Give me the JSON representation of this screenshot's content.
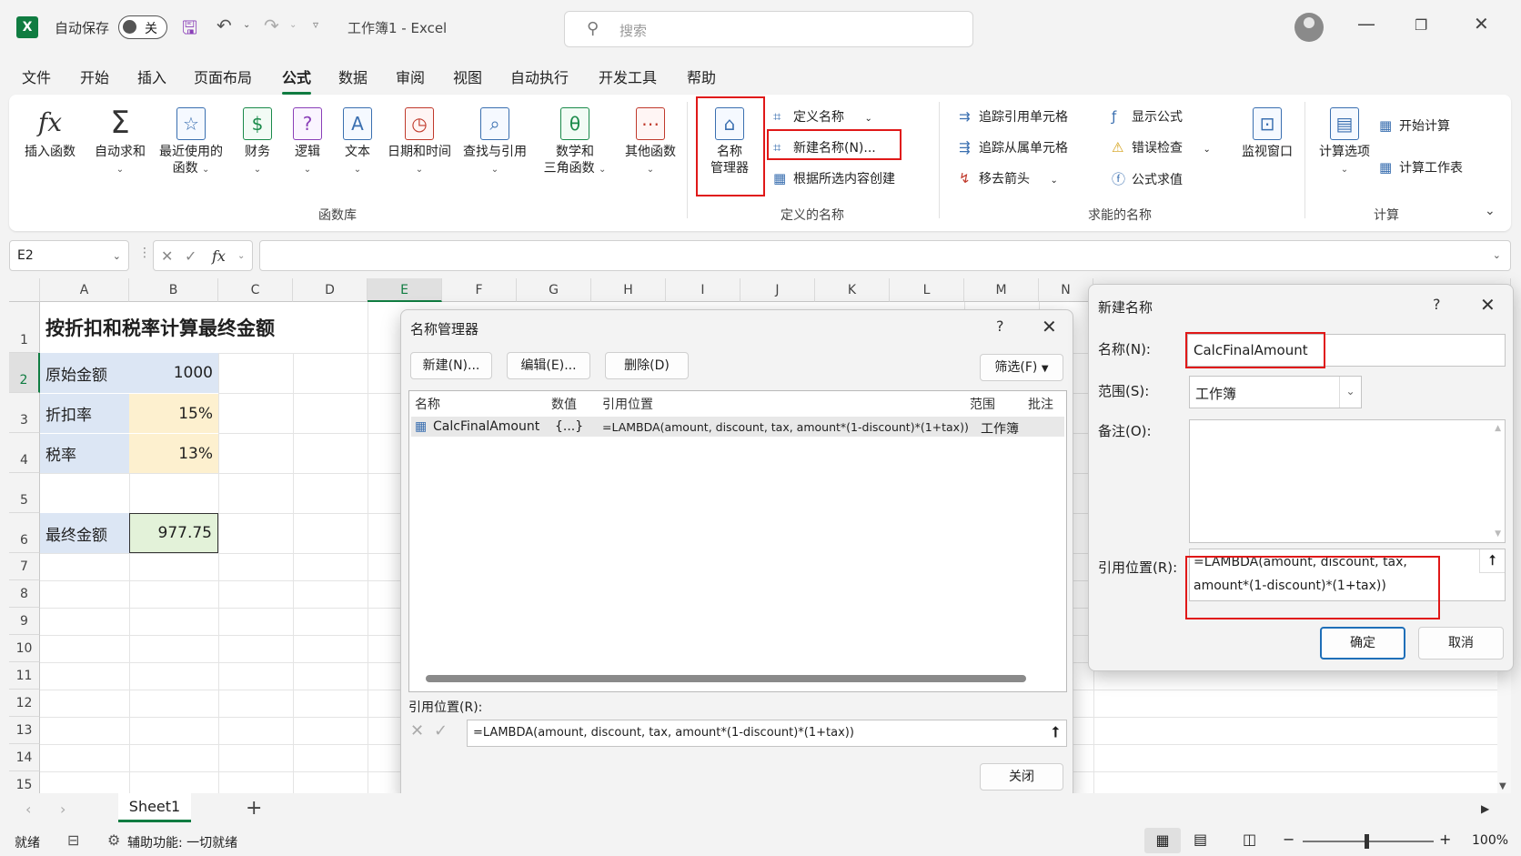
{
  "titlebar": {
    "app_icon": "X",
    "autosave_label": "自动保存",
    "autosave_state": "关",
    "doc_title": "工作簿1  -  Excel",
    "search_placeholder": "搜索"
  },
  "menu": [
    "文件",
    "开始",
    "插入",
    "页面布局",
    "公式",
    "数据",
    "审阅",
    "视图",
    "自动执行",
    "开发工具",
    "帮助"
  ],
  "ribbon": {
    "funclib": {
      "insert_function": "插入函数",
      "autosum": "自动求和",
      "recent_1": "最近使用的",
      "recent_2": "函数",
      "financial": "财务",
      "logical": "逻辑",
      "text": "文本",
      "datetime": "日期和时间",
      "lookup": "查找与引用",
      "math_1": "数学和",
      "math_2": "三角函数",
      "other": "其他函数",
      "group_label": "函数库"
    },
    "defined_names": {
      "name_manager_1": "名称",
      "name_manager_2": "管理器",
      "define_name": "定义名称",
      "new_name": "新建名称(N)...",
      "create_from_selection": "根据所选内容创建",
      "group_label": "定义的名称"
    },
    "audit": {
      "trace_precedents": "追踪引用单元格",
      "trace_dependents": "追踪从属单元格",
      "remove_arrows": "移去箭头",
      "show_formulas": "显示公式",
      "error_checking": "错误检查",
      "evaluate_formula": "公式求值",
      "watch_window": "监视窗口",
      "group_label": "求能的名称"
    },
    "calc": {
      "calc_options": "计算选项",
      "calc_now": "开始计算",
      "calc_sheet": "计算工作表",
      "group_label": "计算"
    }
  },
  "formula_bar": {
    "name_box": "E2",
    "fx": "fx"
  },
  "grid": {
    "columns": [
      "A",
      "B",
      "C",
      "D",
      "E",
      "F",
      "G",
      "H",
      "I",
      "J",
      "K",
      "L",
      "M",
      "N"
    ],
    "rows": [
      "1",
      "2",
      "3",
      "4",
      "5",
      "6",
      "7",
      "8",
      "9",
      "10",
      "11",
      "12",
      "13",
      "14",
      "15"
    ],
    "title": "按折扣和税率计算最终金额",
    "original_label": "原始金额",
    "original_value": "1000",
    "discount_label": "折扣率",
    "discount_value": "15%",
    "tax_label": "税率",
    "tax_value": "13%",
    "final_label": "最终金额",
    "final_value": "977.75",
    "colors": {
      "label_bg": "#dce6f4",
      "rate_bg": "#fdf0cf",
      "result_bg": "#e3f2d9"
    }
  },
  "name_manager": {
    "title": "名称管理器",
    "help": "?",
    "new_btn": "新建(N)...",
    "edit_btn": "编辑(E)...",
    "delete_btn": "删除(D)",
    "filter_btn": "筛选(F)",
    "headers": {
      "name": "名称",
      "value": "数值",
      "refers": "引用位置",
      "scope": "范围",
      "comment": "批注"
    },
    "row": {
      "name": "CalcFinalAmount",
      "value": "{...}",
      "refers": "=LAMBDA(amount, discount, tax, amount*(1-discount)*(1+tax))",
      "scope": "工作簿"
    },
    "refers_label": "引用位置(R):",
    "refers_value": "=LAMBDA(amount, discount, tax, amount*(1-discount)*(1+tax))",
    "close_btn": "关闭"
  },
  "new_name": {
    "title": "新建名称",
    "help": "?",
    "name_label": "名称(N):",
    "name_value": "CalcFinalAmount",
    "scope_label": "范围(S):",
    "scope_value": "工作簿",
    "comment_label": "备注(O):",
    "refers_label": "引用位置(R):",
    "refers_line1": "=LAMBDA(amount, discount, tax,",
    "refers_line2": "amount*(1-discount)*(1+tax))",
    "ok_btn": "确定",
    "cancel_btn": "取消"
  },
  "sheet": {
    "tab": "Sheet1",
    "add": "+"
  },
  "status": {
    "ready": "就绪",
    "accessibility": "辅助功能: 一切就绪",
    "zoom": "100%"
  },
  "accent": "#107c41",
  "highlight": "#e01818"
}
